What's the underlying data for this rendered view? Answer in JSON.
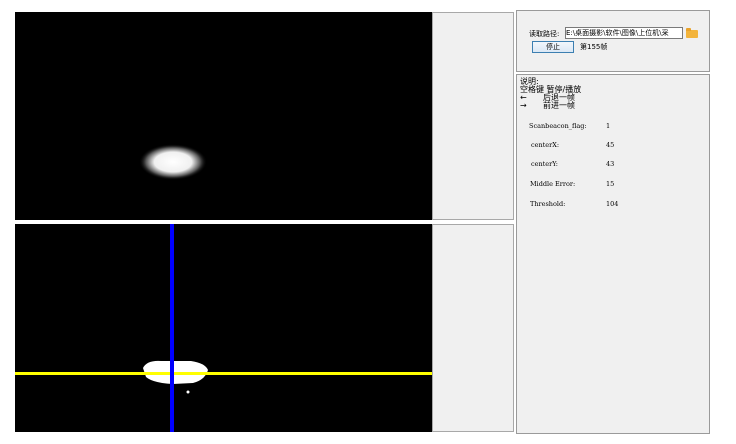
{
  "left_panel": {
    "path_label": "读取路径:",
    "path_value": "E:\\桌面摄影\\软件\\图像\\上位机\\采",
    "stop_button": "停止",
    "frame_text": "第155帧"
  },
  "help": {
    "title": "说明:",
    "line1": "空格键  暂停/播放",
    "line2_key": "←",
    "line2_text": "后退一帧",
    "line3_key": "→",
    "line3_text": "前进一帧"
  },
  "params": [
    {
      "label": "Scanbeacon_flag:",
      "value": "1"
    },
    {
      "label": "centerX:",
      "value": "45"
    },
    {
      "label": "centerY:",
      "value": "43"
    },
    {
      "label": "Middle Error:",
      "value": "15"
    },
    {
      "label": "Threshold:",
      "value": "104"
    }
  ],
  "colors": {
    "crosshair_vertical": "#0000ff",
    "crosshair_horizontal": "#ffff00",
    "folder_icon": "#f3b43c"
  }
}
